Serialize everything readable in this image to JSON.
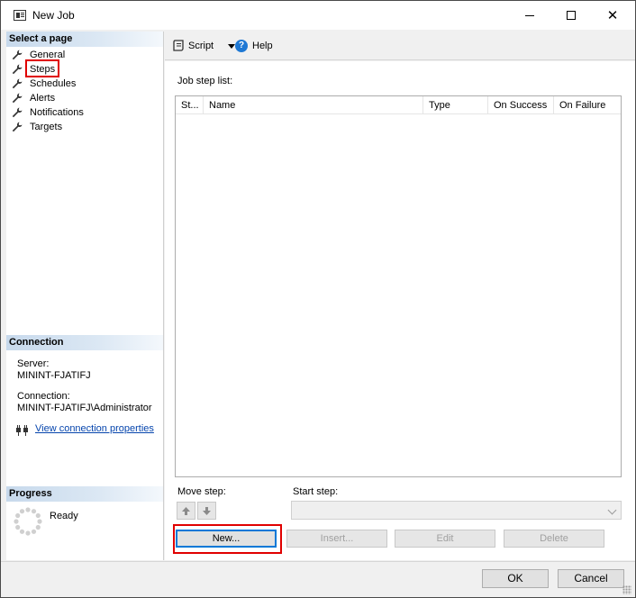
{
  "window": {
    "title": "New Job",
    "controls": {
      "minimize": "minimize",
      "maximize": "maximize",
      "close": "✕"
    }
  },
  "left_pane": {
    "select_page_header": "Select a page",
    "pages": [
      {
        "label": "General",
        "icon": "wrench-icon"
      },
      {
        "label": "Steps",
        "icon": "wrench-icon",
        "selected": true
      },
      {
        "label": "Schedules",
        "icon": "wrench-icon"
      },
      {
        "label": "Alerts",
        "icon": "wrench-icon"
      },
      {
        "label": "Notifications",
        "icon": "wrench-icon"
      },
      {
        "label": "Targets",
        "icon": "wrench-icon"
      }
    ],
    "connection_header": "Connection",
    "server_label": "Server:",
    "server_value": "MININT-FJATIFJ",
    "connection_label": "Connection:",
    "connection_value": "MININT-FJATIFJ\\Administrator",
    "view_connection_link": "View connection properties",
    "progress_header": "Progress",
    "progress_status": "Ready"
  },
  "toolbar": {
    "script_label": "Script",
    "help_label": "Help"
  },
  "main": {
    "job_step_list_label": "Job step list:",
    "columns": [
      "St...",
      "Name",
      "Type",
      "On Success",
      "On Failure"
    ],
    "rows": [],
    "move_step_label": "Move step:",
    "start_step_label": "Start step:",
    "start_step_value": "",
    "buttons": {
      "new": "New...",
      "insert": "Insert...",
      "edit": "Edit",
      "delete": "Delete"
    }
  },
  "footer": {
    "ok": "OK",
    "cancel": "Cancel"
  },
  "colors": {
    "highlight_red": "#e00000",
    "link_blue": "#0645ad",
    "focus_blue": "#0078d7",
    "header_gradient_start": "#c7d9ec"
  }
}
